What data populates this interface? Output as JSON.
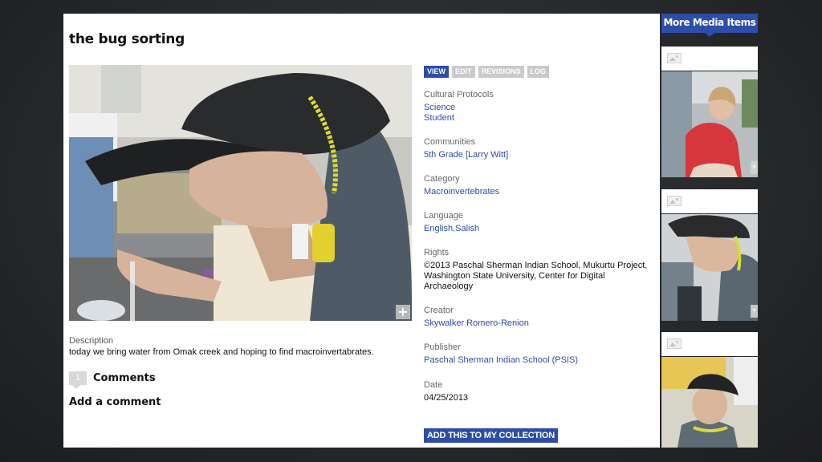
{
  "page": {
    "title": "the bug sorting",
    "description_label": "Description",
    "description": "today we bring water from Omak creek and hoping to find macroinvertabrates.",
    "comments_count": "1",
    "comments_label": "Comments",
    "add_comment": "Add a comment"
  },
  "tabs": [
    {
      "label": "VIEW",
      "active": true
    },
    {
      "label": "EDIT",
      "active": false
    },
    {
      "label": "REVISIONS",
      "active": false
    },
    {
      "label": "LOG",
      "active": false
    }
  ],
  "metadata": {
    "cultural_protocols": {
      "label": "Cultural Protocols",
      "values": [
        "Science",
        "Student"
      ]
    },
    "communities": {
      "label": "Communities",
      "value": "5th Grade [Larry Witt]"
    },
    "category": {
      "label": "Category",
      "value": "Macroinvertebrates"
    },
    "language": {
      "label": "Language",
      "value": "English,Salish"
    },
    "rights": {
      "label": "Rights",
      "lines": [
        "©2013 Paschal Sherman Indian School, Mukurtu Project,",
        "Washington State University, Center for Digital",
        "Archaeology"
      ]
    },
    "creator": {
      "label": "Creator",
      "value": "Skywalker Romero-Renion"
    },
    "publisher": {
      "label": "Publisher",
      "value": "Paschal Sherman Indian School (PSIS)"
    },
    "date": {
      "label": "Date",
      "value": "04/25/2013"
    }
  },
  "actions": {
    "add_collection": "ADD THIS TO MY COLLECTION"
  },
  "sidebar": {
    "title": "More Media Items",
    "item_icon": "image-icon",
    "thumb_plus": "+"
  },
  "main_image": {
    "plus": "+"
  },
  "colors": {
    "accent": "#2d4da8",
    "tab_inactive": "#c8cacc",
    "background": "#26282a"
  }
}
